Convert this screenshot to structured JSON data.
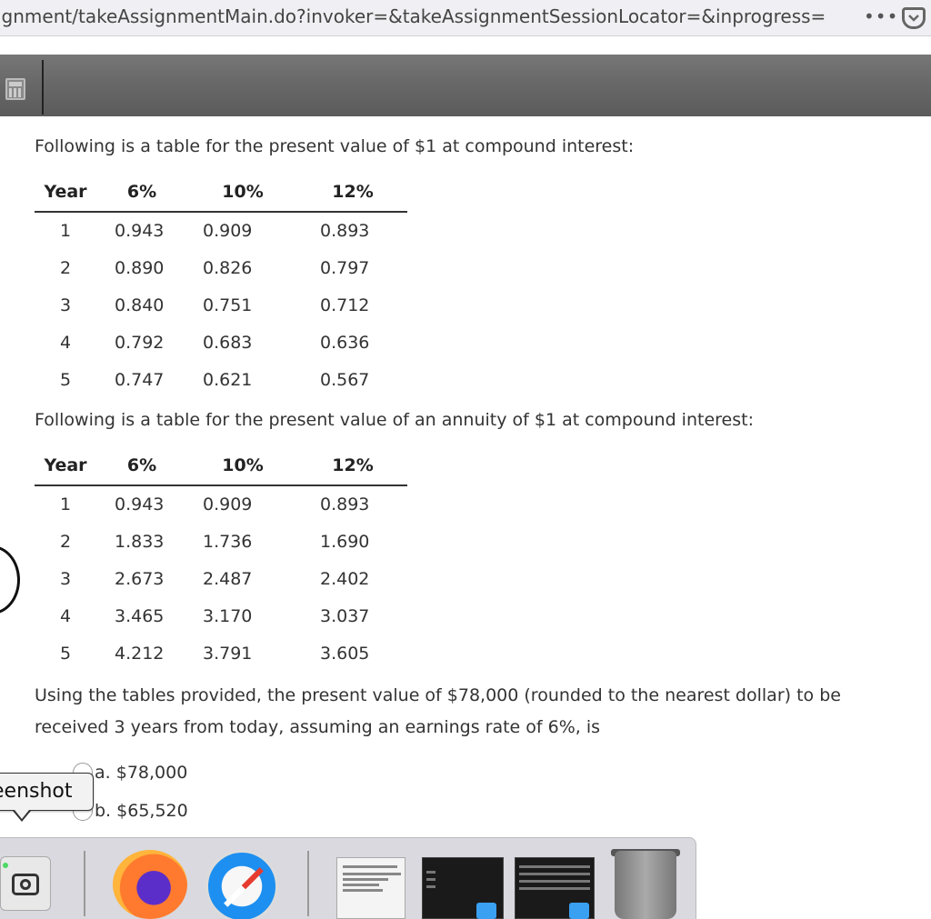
{
  "browser": {
    "url": "ignment/takeAssignmentMain.do?invoker=&takeAssignmentSessionLocator=&inprogress=",
    "overflow_menu": "•••"
  },
  "toolbar": {
    "calculator_icon": "calculator-icon"
  },
  "content": {
    "table1_intro": "Following is a table for the present value of $1 at compound interest:",
    "table1": {
      "headers": [
        "Year",
        "6%",
        "10%",
        "12%"
      ],
      "rows": [
        [
          "1",
          "0.943",
          "0.909",
          "0.893"
        ],
        [
          "2",
          "0.890",
          "0.826",
          "0.797"
        ],
        [
          "3",
          "0.840",
          "0.751",
          "0.712"
        ],
        [
          "4",
          "0.792",
          "0.683",
          "0.636"
        ],
        [
          "5",
          "0.747",
          "0.621",
          "0.567"
        ]
      ]
    },
    "table2_intro": "Following is a table for the present value of an annuity of $1 at compound interest:",
    "table2": {
      "headers": [
        "Year",
        "6%",
        "10%",
        "12%"
      ],
      "rows": [
        [
          "1",
          "0.943",
          "0.909",
          "0.893"
        ],
        [
          "2",
          "1.833",
          "1.736",
          "1.690"
        ],
        [
          "3",
          "2.673",
          "2.487",
          "2.402"
        ],
        [
          "4",
          "3.465",
          "3.170",
          "3.037"
        ],
        [
          "5",
          "4.212",
          "3.791",
          "3.605"
        ]
      ]
    },
    "question": "Using the tables provided, the present value of $78,000 (rounded to the nearest dollar) to be received 3 years from today, assuming an earnings rate of 6%, is",
    "options": [
      {
        "letter": "a.",
        "text": "$78,000"
      },
      {
        "letter": "b.",
        "text": "$65,520"
      }
    ]
  },
  "overlay": {
    "tooltip": "eenshot"
  },
  "dock": {
    "items": [
      "screenshot-app-icon",
      "firefox-icon",
      "safari-icon",
      "document-window-thumbnail",
      "finder-window-thumbnail-1",
      "finder-window-thumbnail-2",
      "trash-icon"
    ]
  }
}
